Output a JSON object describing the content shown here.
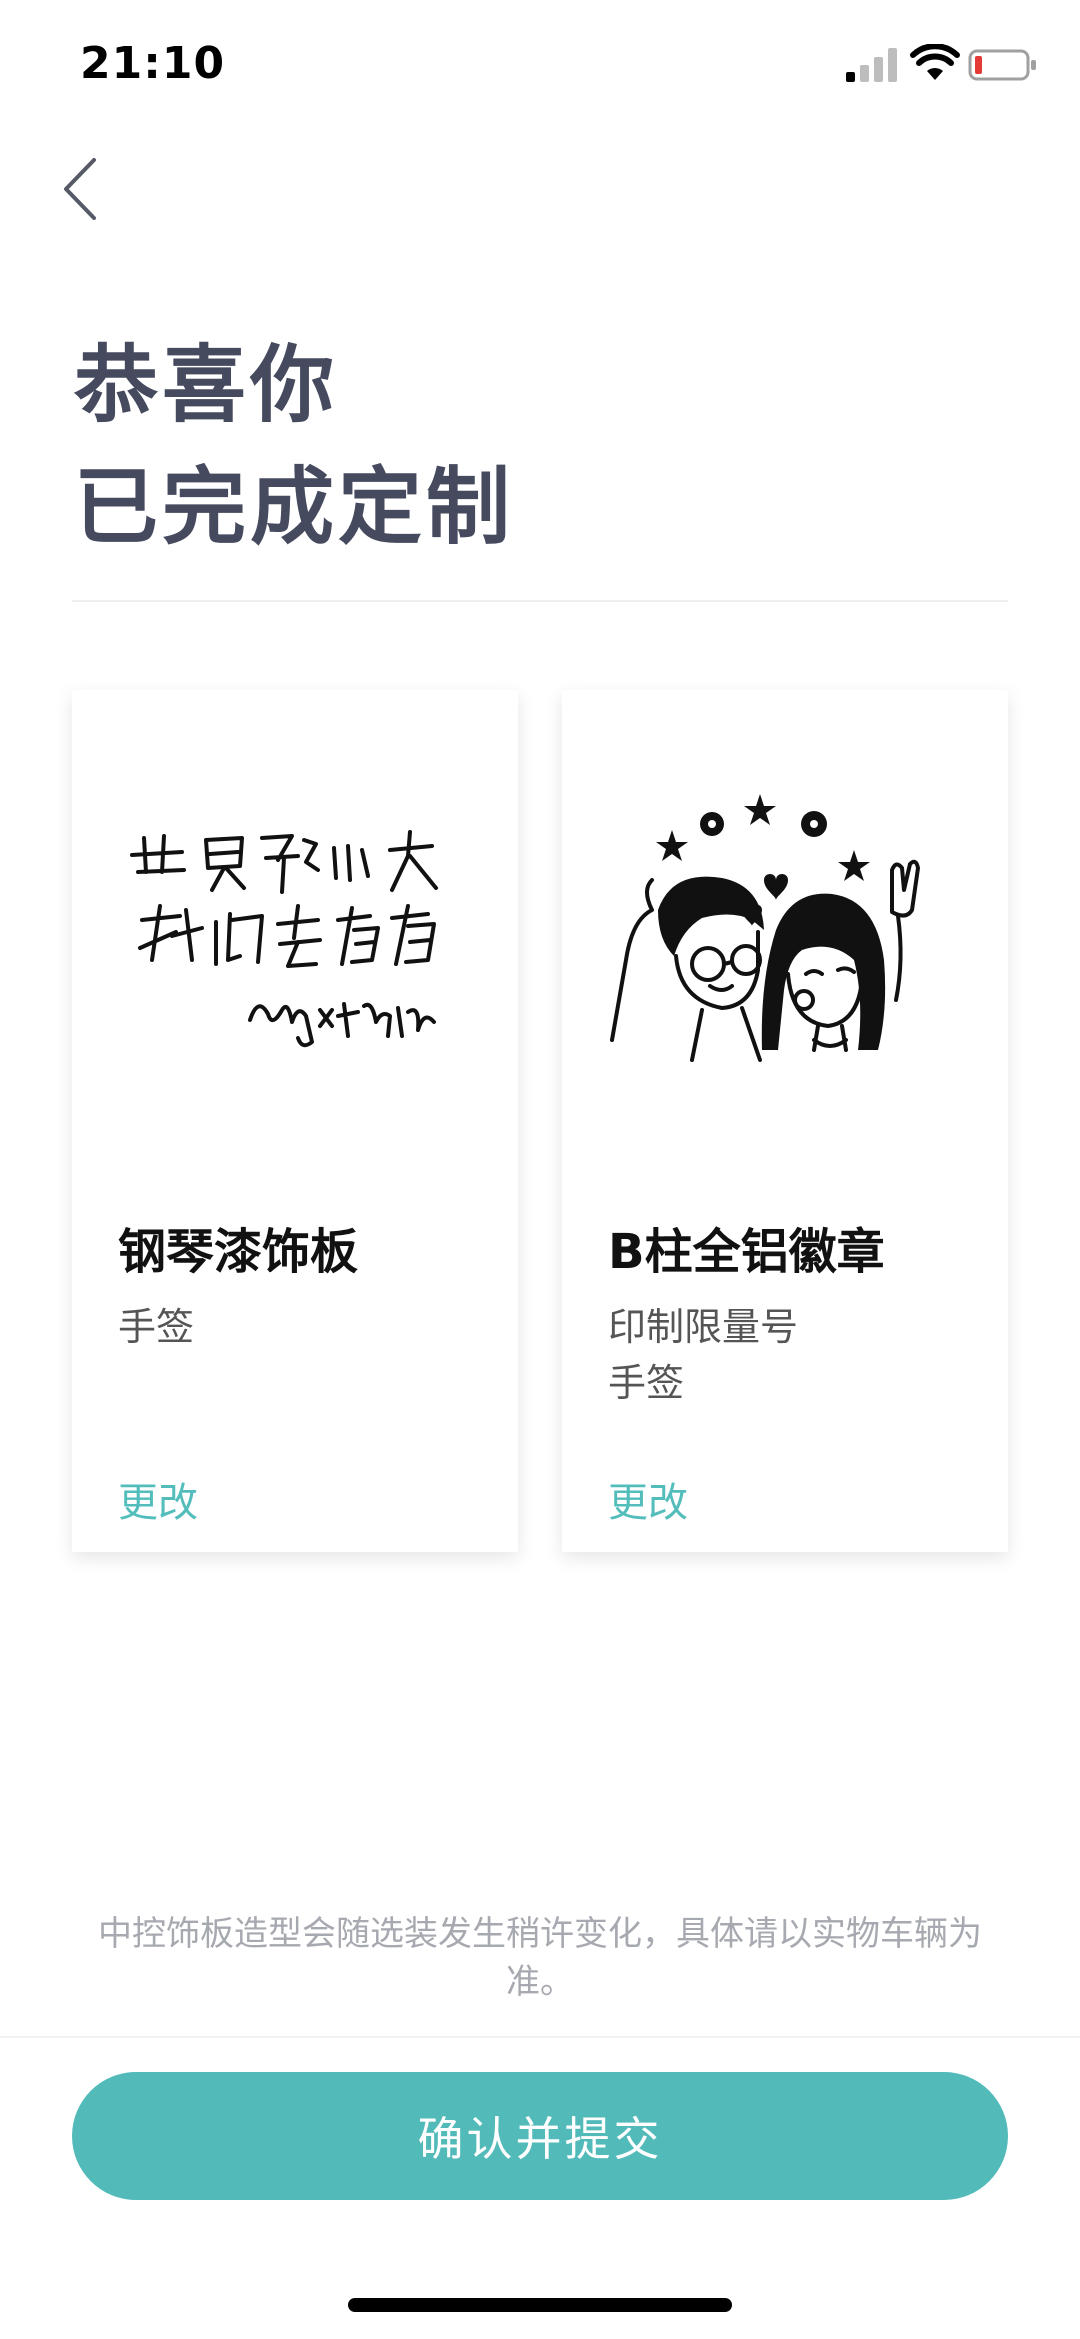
{
  "status_bar": {
    "time": "21:10"
  },
  "header": {
    "title_line1": "恭喜你",
    "title_line2": "已完成定制"
  },
  "cards": [
    {
      "title": "钢琴漆饰板",
      "options": [
        "手签"
      ],
      "change_label": "更改",
      "image_icon": "handwritten-signature"
    },
    {
      "title": "B柱全铝徽章",
      "options": [
        "印制限量号",
        "手签"
      ],
      "change_label": "更改",
      "image_icon": "cartoon-couple-illustration"
    }
  ],
  "note": "中控饰板造型会随选装发生稍许变化，具体请以实物车辆为准。",
  "confirm_label": "确认并提交",
  "colors": {
    "accent": "#52bbb9",
    "title": "#454a5e",
    "note": "#a7a9b0",
    "battery_low": "#e53935"
  }
}
